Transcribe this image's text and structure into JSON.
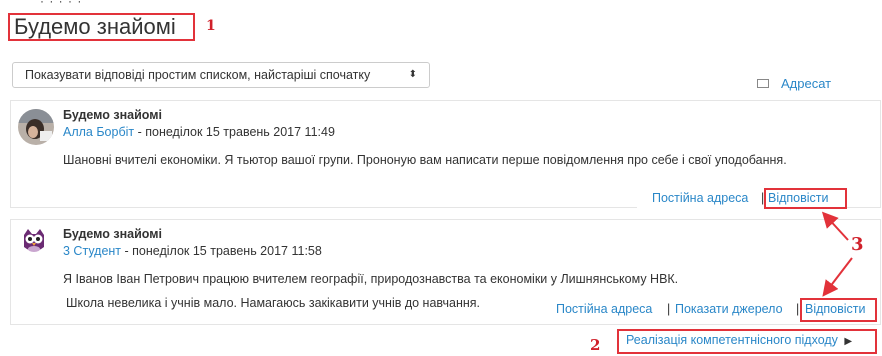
{
  "top_fragment": "· · · · ·",
  "page_title": "Будемо знайомі",
  "markers": {
    "one": "1",
    "two": "2",
    "three": "3"
  },
  "sort_select": {
    "value": "Показувати відповіді простим списком, найстаріші спочатку",
    "caret": "⬍"
  },
  "subscribe_label": "Адресат",
  "posts": [
    {
      "subject": "Будемо знайомі",
      "author": "Алла Борбіт",
      "date": " - понеділок 15 травень 2017 11:49",
      "lines": [
        "Шановні вчителі економіки. Я тьютор вашої групи. Прононую вам написати перше повідомлення про себе і свої уподобання."
      ],
      "links": {
        "permalink": "Постійна адреса",
        "reply": "Відповісти"
      }
    },
    {
      "subject": "Будемо знайомі",
      "author": "3 Студент",
      "date": " - понеділок 15 травень 2017 11:58",
      "lines": [
        "Я Іванов Іван Петрович працюю вчителем географії, природознавства та економіки у Лишнянському НВК.",
        "Школа невелика і учнів мало. Намагаюсь закікавити учнів до навчання."
      ],
      "links": {
        "permalink": "Постійна адреса",
        "show_source": "Показати джерело",
        "reply": "Відповісти"
      }
    }
  ],
  "next_discussion": {
    "label": "Реалізація компетентнісного підходу",
    "arrow": "▶"
  },
  "colors": {
    "accent": "#2a87c8",
    "annotation_red": "#e2323a"
  }
}
